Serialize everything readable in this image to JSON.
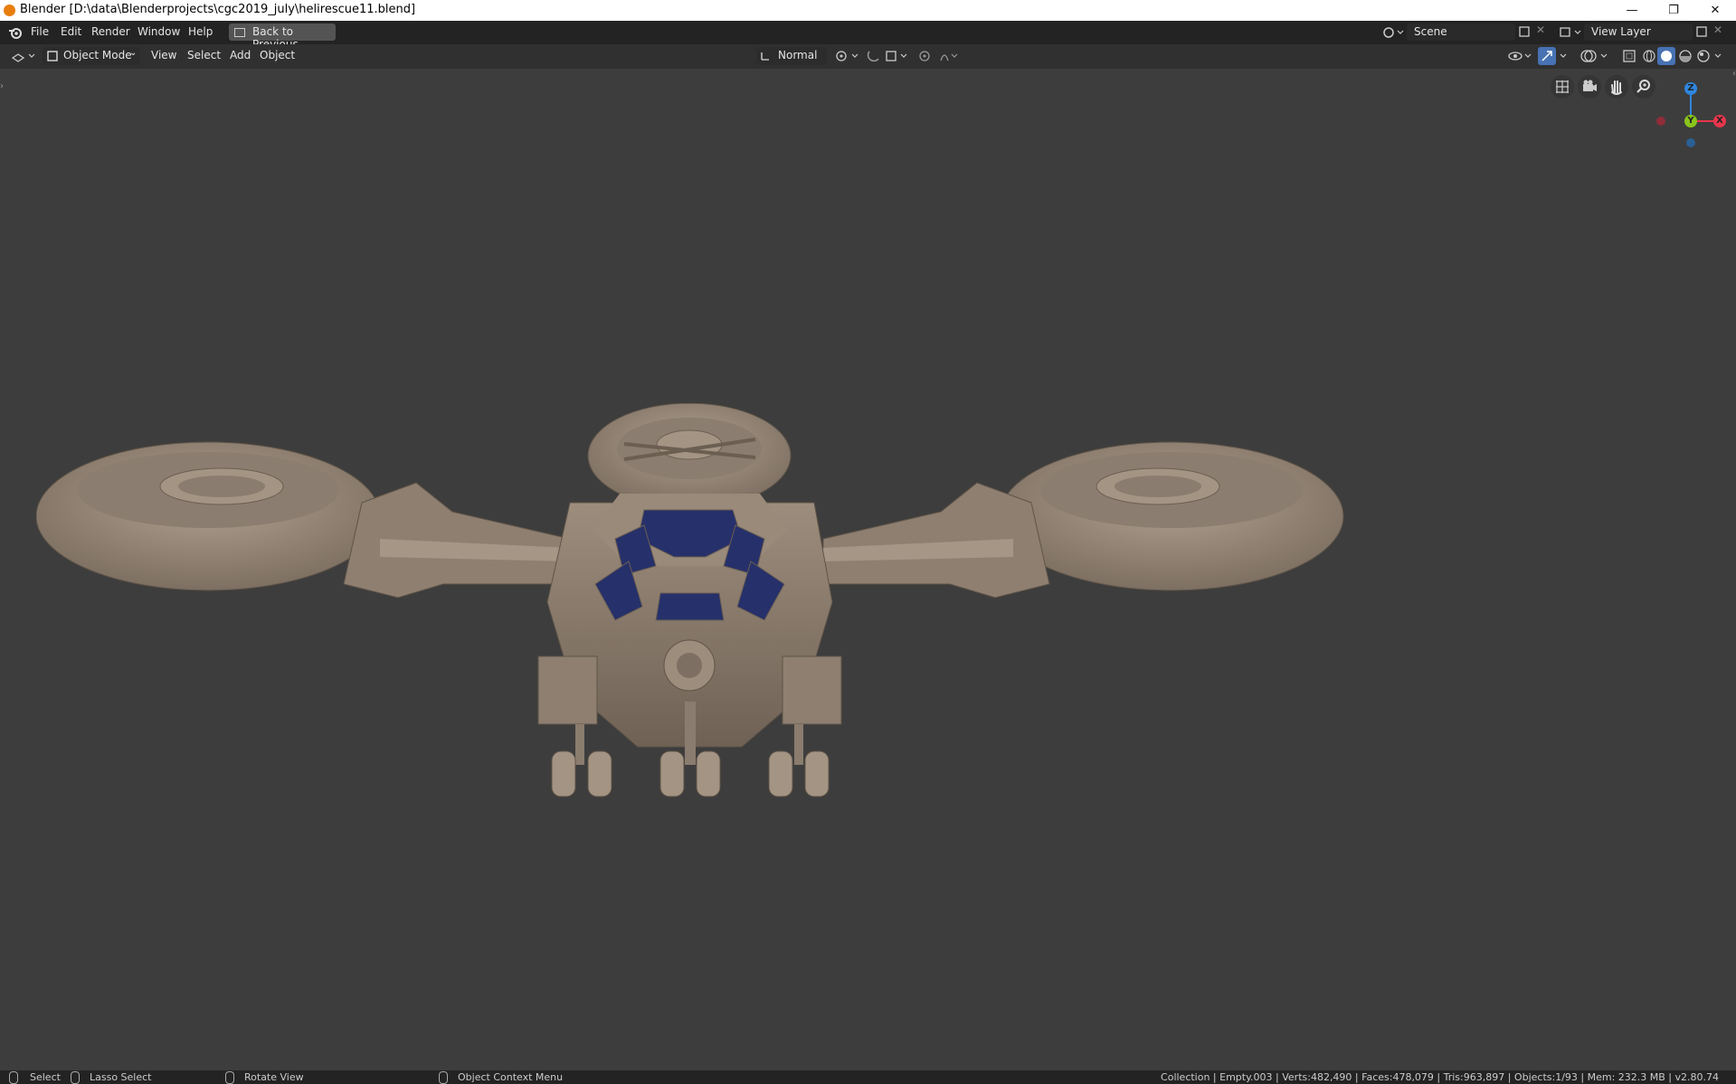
{
  "window": {
    "title": "Blender [D:\\data\\Blenderprojects\\cgc2019_july\\helirescue11.blend]",
    "controls": {
      "minimize": "—",
      "restore": "❐",
      "close": "✕"
    }
  },
  "topbar": {
    "menus": [
      "File",
      "Edit",
      "Render",
      "Window",
      "Help"
    ],
    "back_button": "Back to Previous",
    "scene_field": "Scene",
    "view_layer_field": "View Layer"
  },
  "header": {
    "mode": "Object Mode",
    "menus": [
      "View",
      "Select",
      "Add",
      "Object"
    ],
    "transform_orientation": "Normal"
  },
  "gizmo": {
    "z": "Z",
    "y": "Y",
    "x": "X"
  },
  "statusbar": {
    "select": "Select",
    "lasso_select": "Lasso Select",
    "rotate_view": "Rotate View",
    "context_menu": "Object Context Menu",
    "stats": "Collection | Empty.003 | Verts:482,490 | Faces:478,079 | Tris:963,897 | Objects:1/93 | Mem: 232.3 MB | v2.80.74"
  },
  "colors": {
    "model": "#948474",
    "glass": "#26306a",
    "viewport_bg": "#3d3d3d",
    "x_axis": "#e8364b",
    "y_axis": "#8ac41c",
    "z_axis": "#2e86de"
  }
}
